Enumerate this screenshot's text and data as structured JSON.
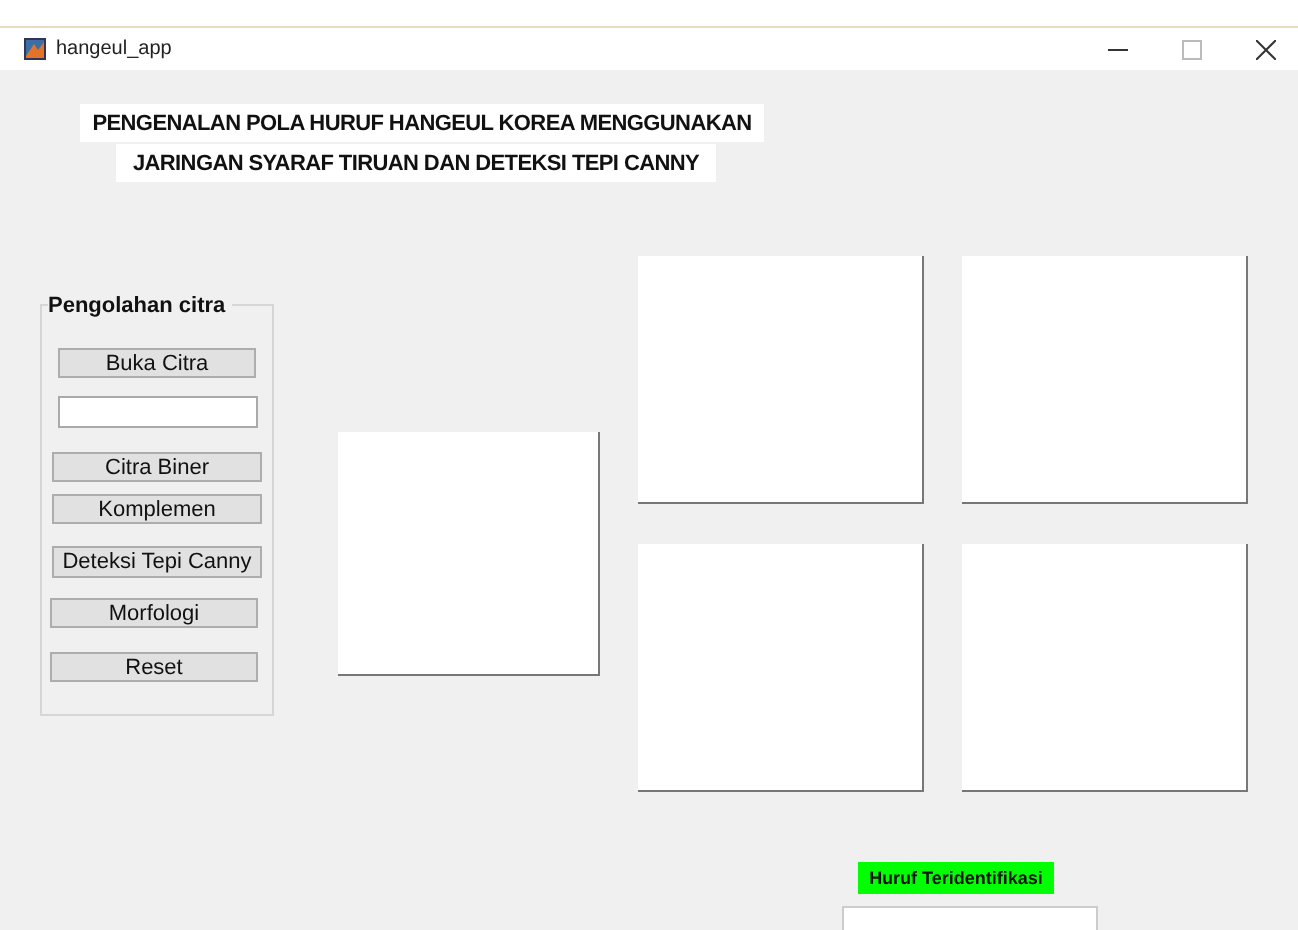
{
  "window": {
    "title": "hangeul_app"
  },
  "heading": [
    "PENGENALAN POLA HURUF HANGEUL KOREA MENGGUNAKAN",
    "JARINGAN SYARAF TIRUAN DAN DETEKSI TEPI CANNY"
  ],
  "panel": {
    "title": "Pengolahan citra",
    "controls": [
      {
        "kind": "button",
        "label": "Buka Citra"
      },
      {
        "kind": "field"
      },
      {
        "kind": "button",
        "label": "Citra Biner"
      },
      {
        "kind": "button",
        "label": "Komplemen"
      },
      {
        "kind": "button",
        "label": "Deteksi Tepi Canny"
      },
      {
        "kind": "button",
        "label": "Morfologi"
      },
      {
        "kind": "button",
        "label": "Reset"
      }
    ]
  },
  "result": {
    "label": "Huruf Teridentifikasi"
  }
}
